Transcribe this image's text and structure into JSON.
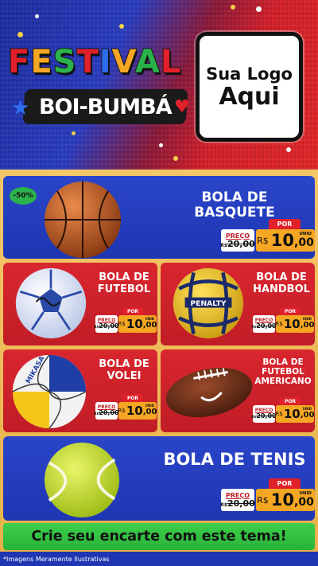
{
  "header": {
    "title_word": [
      "F",
      "E",
      "S",
      "T",
      "I",
      "V",
      "A",
      "L"
    ],
    "title_colors": [
      "#e0212b",
      "#f5a623",
      "#2bb24a",
      "#e0212b",
      "#2e6df0",
      "#f5a623",
      "#2bb24a",
      "#e0212b"
    ],
    "subtitle": "BOI-BUMBÁ",
    "logo_line1": "Sua Logo",
    "logo_line2": "Aqui"
  },
  "products": [
    {
      "name": "BOLA DE BASQUETE",
      "badge": "-50%",
      "tag_por": "POR",
      "tag_preco": "PREÇO",
      "tag_old_prefix": "R$",
      "tag_old": "20,00",
      "tag_currency": "R$",
      "tag_int": "10",
      "tag_dec": ",00",
      "tag_unid": "UNID"
    },
    {
      "name_l1": "BOLA DE",
      "name_l2": "FUTEBOL",
      "tag_por": "POR",
      "tag_preco": "PREÇO",
      "tag_old_prefix": "R$",
      "tag_old": "20,00",
      "tag_currency": "R$",
      "tag_int": "10",
      "tag_dec": ",00",
      "tag_unid": "UNID"
    },
    {
      "name_l1": "BOLA DE",
      "name_l2": "HANDBOL",
      "tag_por": "POR",
      "tag_preco": "PREÇO",
      "tag_old_prefix": "R$",
      "tag_old": "20,00",
      "tag_currency": "R$",
      "tag_int": "10",
      "tag_dec": ",00",
      "tag_unid": "UNID"
    },
    {
      "name_l1": "BOLA DE",
      "name_l2": "VOLEI",
      "tag_por": "POR",
      "tag_preco": "PREÇO",
      "tag_old_prefix": "R$",
      "tag_old": "20,00",
      "tag_currency": "R$",
      "tag_int": "10",
      "tag_dec": ",00",
      "tag_unid": "UNID"
    },
    {
      "name_l1": "BOLA DE",
      "name_l2": "FUTEBOL",
      "name_l3": "AMERICANO",
      "tag_por": "POR",
      "tag_preco": "PREÇO",
      "tag_old_prefix": "R$",
      "tag_old": "20,00",
      "tag_currency": "R$",
      "tag_int": "10",
      "tag_dec": ",00",
      "tag_unid": "UNID"
    },
    {
      "name": "BOLA DE TENIS",
      "tag_por": "POR",
      "tag_preco": "PREÇO",
      "tag_old_prefix": "R$",
      "tag_old": "20,00",
      "tag_currency": "R$",
      "tag_int": "10",
      "tag_dec": ",00",
      "tag_unid": "UNID"
    }
  ],
  "cta": "Crie seu encarte com este tema!",
  "footer_note": "*Imagens Meramente Ilustrativas",
  "colors": {
    "blue_card": "#2a45c9",
    "red_card": "#d9262f",
    "price_orange": "#f5a623",
    "cta_green": "#3ccf4a"
  }
}
